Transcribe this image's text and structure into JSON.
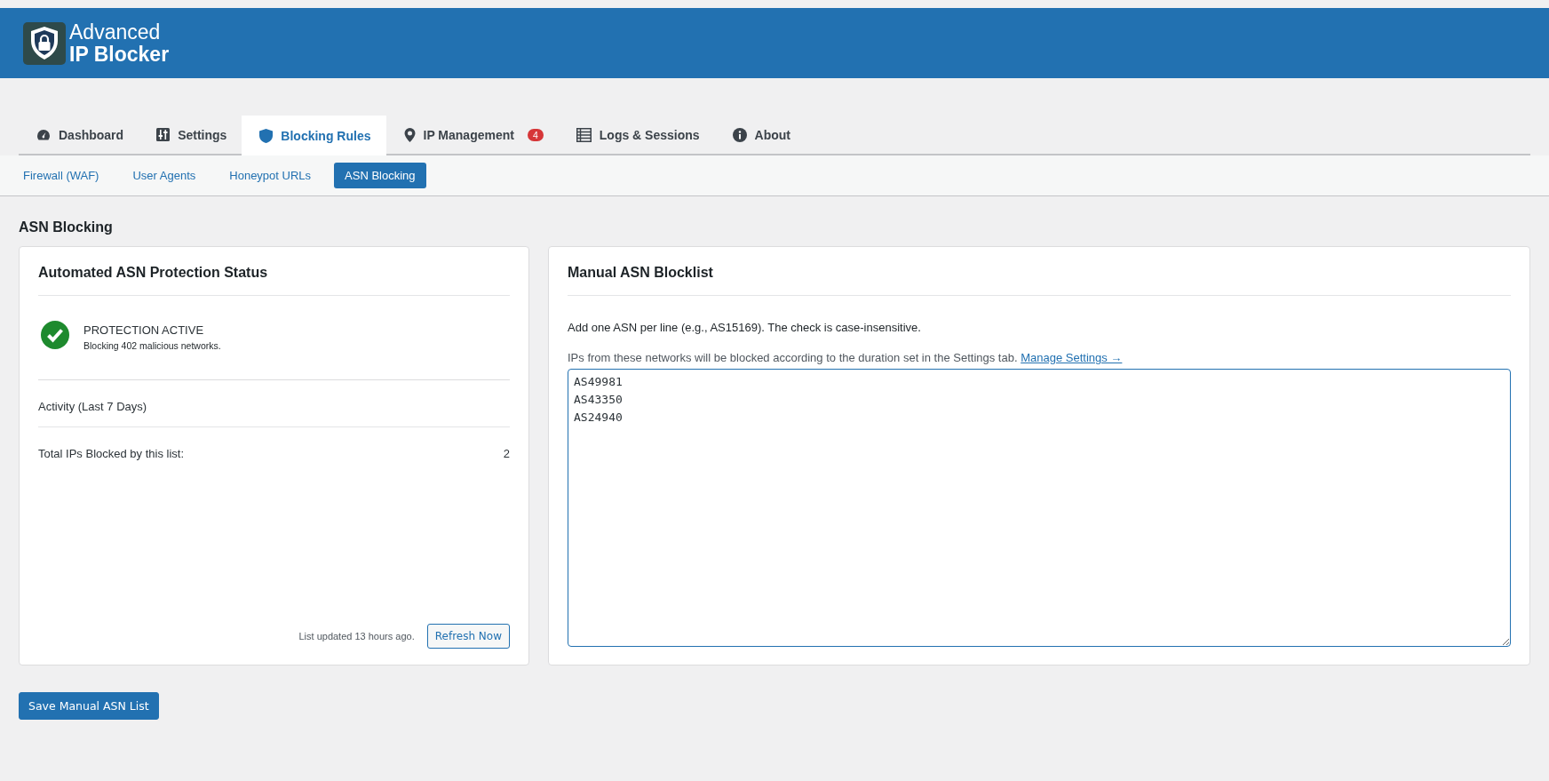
{
  "header": {
    "title_line1": "Advanced",
    "title_line2": "IP Blocker"
  },
  "tabs": [
    {
      "label": "Dashboard",
      "selected": false
    },
    {
      "label": "Settings",
      "selected": false
    },
    {
      "label": "Blocking Rules",
      "selected": true
    },
    {
      "label": "IP Management",
      "selected": false,
      "badge": "4"
    },
    {
      "label": "Logs & Sessions",
      "selected": false
    },
    {
      "label": "About",
      "selected": false
    }
  ],
  "subtabs": [
    {
      "label": "Firewall (WAF)",
      "selected": false
    },
    {
      "label": "User Agents",
      "selected": false
    },
    {
      "label": "Honeypot URLs",
      "selected": false
    },
    {
      "label": "ASN Blocking",
      "selected": true
    }
  ],
  "page_title": "ASN Blocking",
  "status_card": {
    "title": "Automated ASN Protection Status",
    "active": true,
    "status": "PROTECTION ACTIVE",
    "detail": "Blocking 402 malicious networks.",
    "activity_label": "Activity (Last 7 Days)",
    "total_label": "Total IPs Blocked by this list:",
    "total_value": "2",
    "updated": "List updated 13 hours ago.",
    "refresh_button": "Refresh Now"
  },
  "manual_card": {
    "title": "Manual ASN Blocklist",
    "help": "Add one ASN per line (e.g., AS15169). The check is case-insensitive.",
    "note": "IPs from these networks will be blocked according to the duration set in the Settings tab.",
    "note_link": "Manage Settings →",
    "asn_list": "AS49981\nAS43350\nAS24940"
  },
  "save_button": "Save Manual ASN List"
}
